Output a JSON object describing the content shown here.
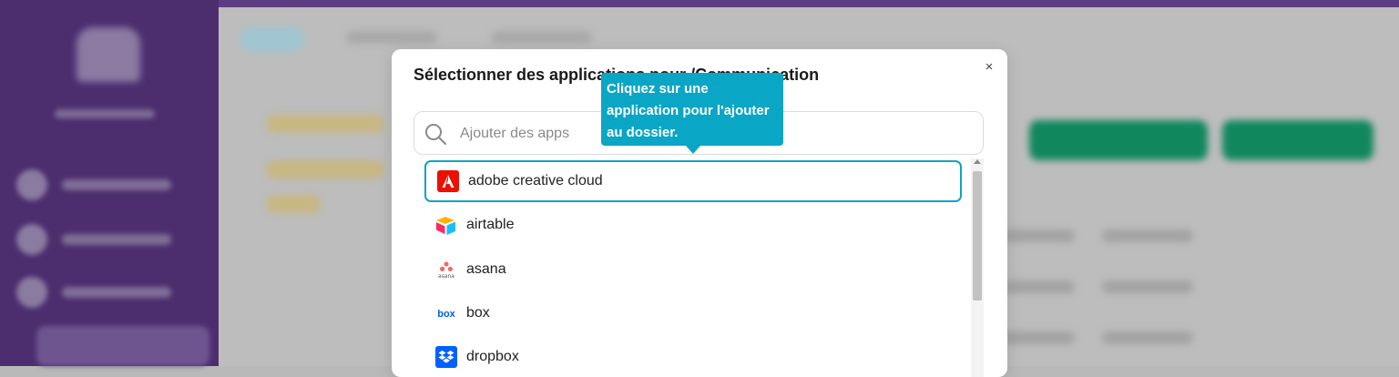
{
  "modal": {
    "title": "Sélectionner des applications pour /Communication",
    "close_label": "×",
    "search": {
      "placeholder": "Ajouter des apps",
      "value": ""
    },
    "tooltip": "Cliquez sur une application pour l'ajouter au dossier.",
    "apps": [
      {
        "label": "adobe creative cloud",
        "icon": "adobe-icon"
      },
      {
        "label": "airtable",
        "icon": "airtable-icon"
      },
      {
        "label": "asana",
        "icon": "asana-icon"
      },
      {
        "label": "box",
        "icon": "box-icon"
      },
      {
        "label": "dropbox",
        "icon": "dropbox-icon"
      }
    ]
  },
  "colors": {
    "accent": "#14a1c2",
    "tooltip": "#0aa6c6",
    "sidebar": "#4c2e6e",
    "adobe": "#eb1000",
    "dropbox": "#0061fe",
    "asana": "#f06a6a",
    "box": "#0061d5"
  }
}
